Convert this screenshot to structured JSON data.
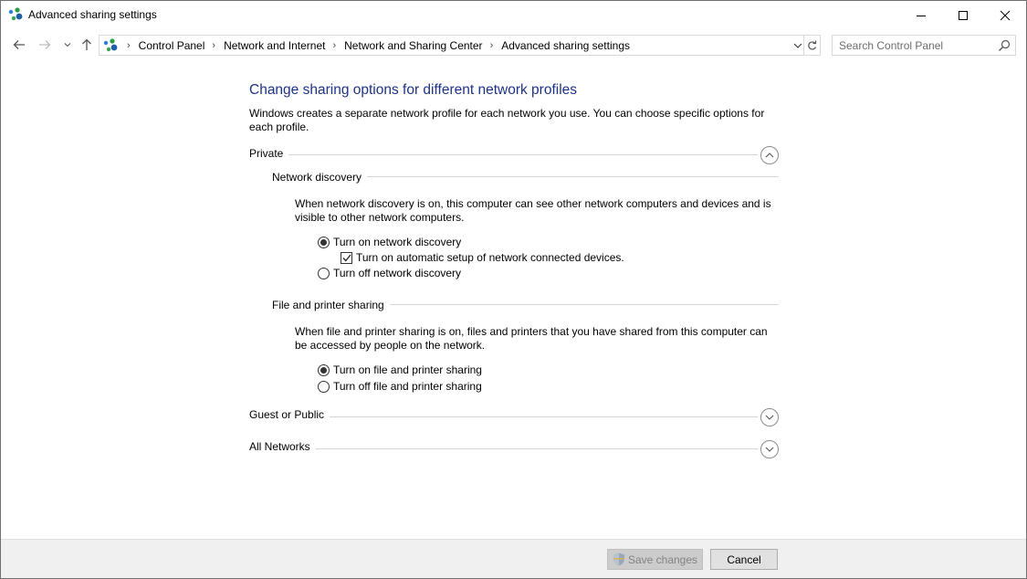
{
  "window": {
    "title": "Advanced sharing settings",
    "icon": "network-sharing-icon"
  },
  "titlebar_buttons": {
    "minimize": "minimize-icon",
    "maximize": "maximize-icon",
    "close": "close-icon"
  },
  "nav": {
    "back": "back-arrow-icon",
    "forward": "forward-arrow-icon",
    "recent": "chevron-down-icon",
    "up": "up-arrow-icon"
  },
  "address": {
    "breadcrumbs": [
      "Control Panel",
      "Network and Internet",
      "Network and Sharing Center",
      "Advanced sharing settings"
    ],
    "separator": "›"
  },
  "search": {
    "placeholder": "Search Control Panel",
    "value": ""
  },
  "main": {
    "heading": "Change sharing options for different network profiles",
    "intro": "Windows creates a separate network profile for each network you use. You can choose specific options for each profile.",
    "profiles": {
      "private": {
        "label": "Private",
        "expanded": true,
        "network_discovery": {
          "label": "Network discovery",
          "description": "When network discovery is on, this computer can see other network computers and devices and is visible to other network computers.",
          "option_on": "Turn on network discovery",
          "option_auto_setup": "Turn on automatic setup of network connected devices.",
          "option_off": "Turn off network discovery",
          "selected": "on",
          "auto_setup_checked": true
        },
        "file_printer_sharing": {
          "label": "File and printer sharing",
          "description": "When file and printer sharing is on, files and printers that you have shared from this computer can be accessed by people on the network.",
          "option_on": "Turn on file and printer sharing",
          "option_off": "Turn off file and printer sharing",
          "selected": "on"
        }
      },
      "guest_public": {
        "label": "Guest or Public",
        "expanded": false
      },
      "all_networks": {
        "label": "All Networks",
        "expanded": false
      }
    }
  },
  "footer": {
    "save_label": "Save changes",
    "save_enabled": false,
    "cancel_label": "Cancel"
  },
  "colors": {
    "heading": "#1e3287",
    "footer_bg": "#f0f0f0",
    "disabled_text": "#838383"
  }
}
